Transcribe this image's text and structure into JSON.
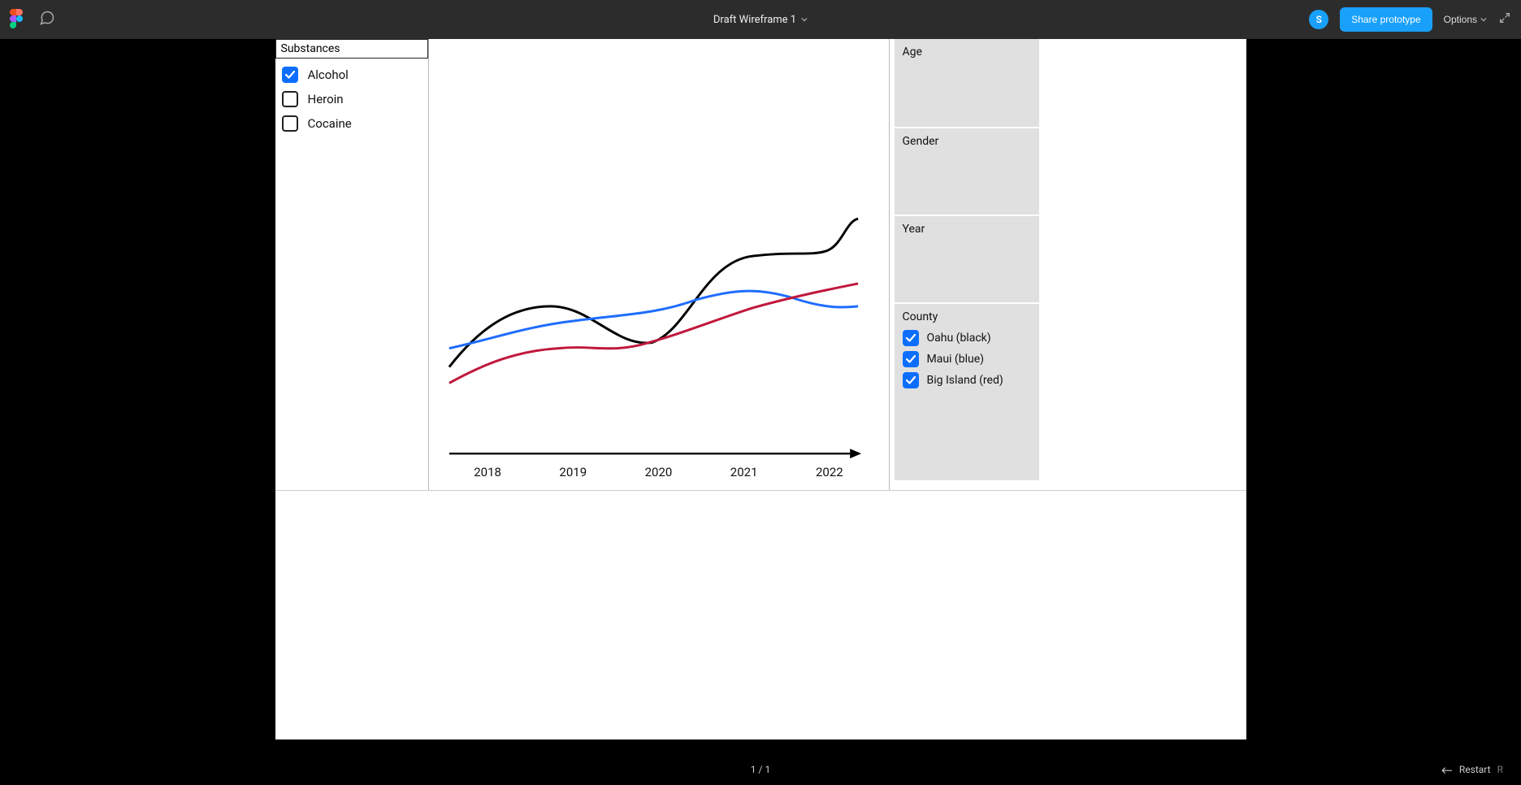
{
  "header": {
    "title": "Draft Wireframe 1",
    "avatar_initial": "S",
    "share_label": "Share prototype",
    "options_label": "Options"
  },
  "substances": {
    "title": "Substances",
    "items": [
      {
        "label": "Alcohol",
        "checked": true
      },
      {
        "label": "Heroin",
        "checked": false
      },
      {
        "label": "Cocaine",
        "checked": false
      }
    ]
  },
  "panels": {
    "age": "Age",
    "gender": "Gender",
    "year": "Year",
    "county": {
      "title": "County",
      "items": [
        {
          "label": "Oahu (black)",
          "checked": true
        },
        {
          "label": "Maui (blue)",
          "checked": true
        },
        {
          "label": "Big Island (red)",
          "checked": true
        }
      ]
    }
  },
  "chart_data": {
    "type": "line",
    "categories": [
      "2018",
      "2019",
      "2020",
      "2021",
      "2022"
    ],
    "series": [
      {
        "name": "Oahu",
        "color": "#000000",
        "values": [
          20,
          35,
          30,
          66,
          80
        ]
      },
      {
        "name": "Maui",
        "color": "#1f6dff",
        "values": [
          32,
          40,
          48,
          55,
          50
        ]
      },
      {
        "name": "Big Island",
        "color": "#c0183c",
        "values": [
          15,
          28,
          34,
          46,
          56
        ]
      }
    ],
    "xlabel": "",
    "ylabel": "",
    "ylim": [
      0,
      100
    ]
  },
  "footer": {
    "page_indicator": "1 / 1",
    "restart_label": "Restart",
    "restart_shortcut": "R"
  }
}
